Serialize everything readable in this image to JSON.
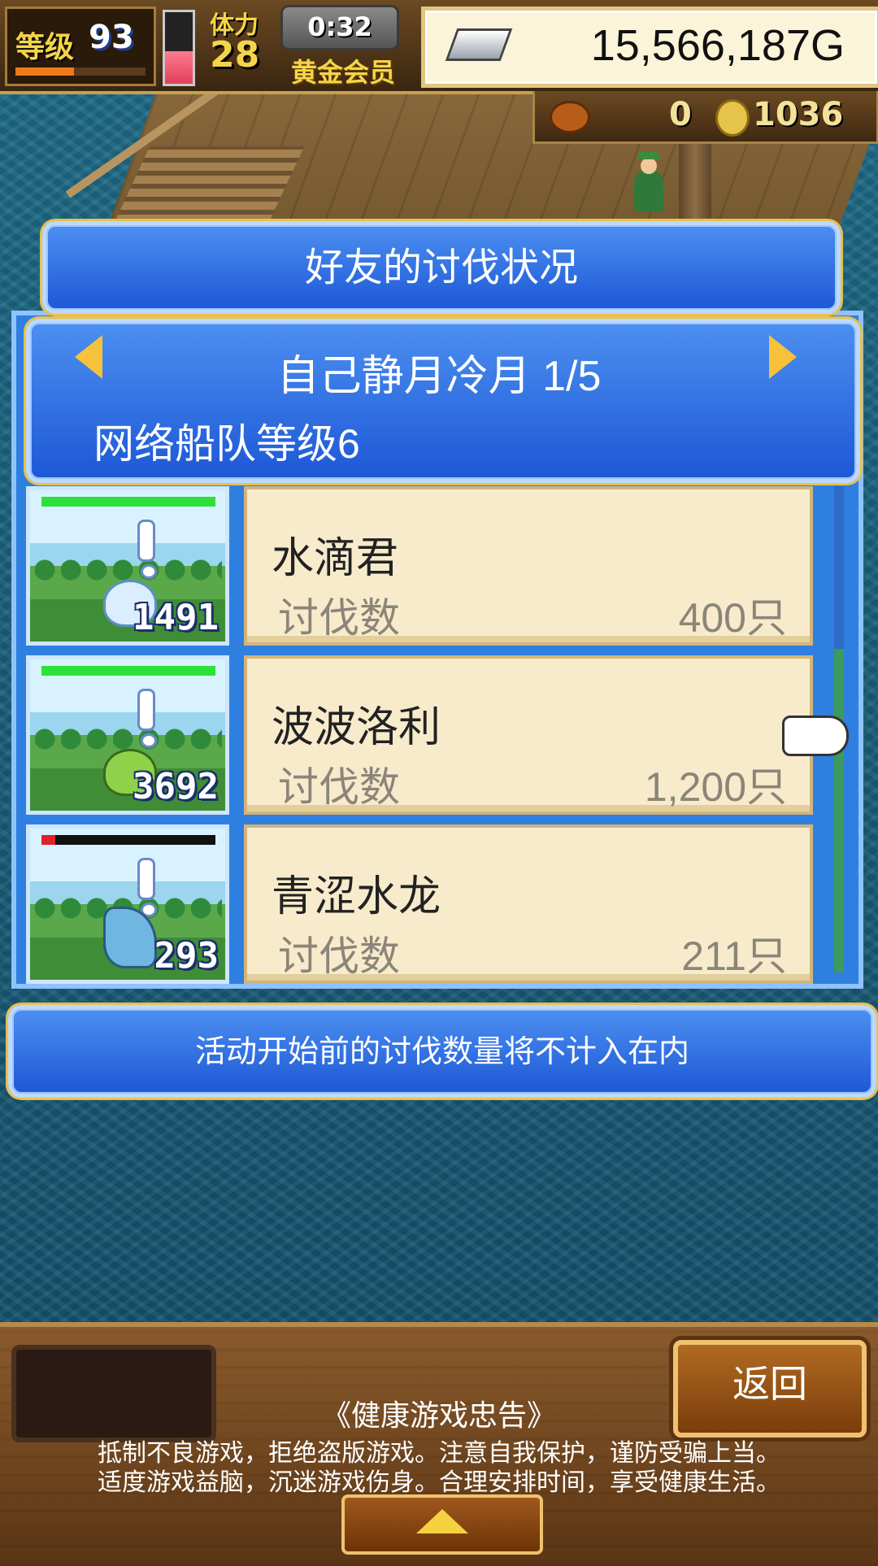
{
  "hud": {
    "level_label": "等级",
    "level_value": "93",
    "level_progress": 0.45,
    "stamina_label": "体力",
    "stamina_value": "28",
    "stamina_fill": 0.45,
    "timer": "0:32",
    "member_label": "黄金会员",
    "gold": "15,566,187G",
    "resource_food": "0",
    "resource_coins": "1036"
  },
  "dialog": {
    "title": "好友的讨伐状况",
    "player": "自己静月冷月 1/5",
    "fleet_level": "网络船队等级6",
    "entries": [
      {
        "thumb_count": "1491",
        "hp": 1.0,
        "name": "水滴君",
        "label": "讨伐数",
        "value": "400只"
      },
      {
        "thumb_count": "3692",
        "hp": 1.0,
        "name": "波波洛利",
        "label": "讨伐数",
        "value": "1,200只"
      },
      {
        "thumb_count": "293",
        "hp": 0.08,
        "name": "青涩水龙",
        "label": "讨伐数",
        "value": "211只"
      }
    ],
    "note": "活动开始前的讨伐数量将不计入在内"
  },
  "footer": {
    "back_label": "返回",
    "health_title": "《健康游戏忠告》",
    "health_line1": "抵制不良游戏，拒绝盗版游戏。注意自我保护，谨防受骗上当。",
    "health_line2": "适度游戏益脑，沉迷游戏伤身。合理安排时间，享受健康生活。"
  },
  "colors": {
    "panel_blue": "#2f7fe0",
    "card_bg": "#f7ebcc",
    "accent_gold": "#f6c23a"
  },
  "icons": [
    "silver-bar-icon",
    "food-icon",
    "coin-icon",
    "arrow-left-icon",
    "arrow-right-icon",
    "pointer-hand-icon",
    "up-arrow-icon"
  ]
}
